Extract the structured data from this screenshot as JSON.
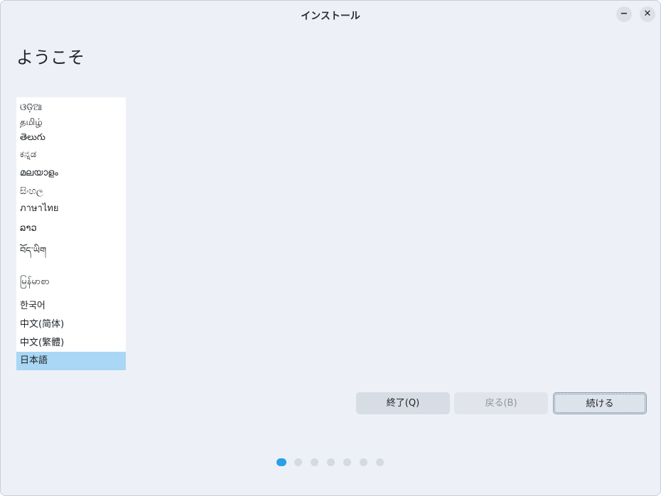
{
  "window": {
    "title": "インストール",
    "minimize_glyph": "−",
    "close_glyph": "✕"
  },
  "page": {
    "heading": "ようこそ"
  },
  "languages": {
    "items": [
      "ଓଡ଼ିଆ",
      "தமிழ்",
      "తెలుగు",
      "ಕನ್ನಡ",
      "മലയാളം",
      "සිංහල",
      "ภาษาไทย",
      "ລາວ",
      "བོད་ཡིག",
      "မြန်မာစာ",
      "한국어",
      "中文(简体)",
      "中文(繁體)",
      "日本語"
    ],
    "selected": "日本語"
  },
  "buttons": {
    "quit_label": "終了(Q)",
    "back_label": "戻る(B)",
    "continue_label": "続ける"
  },
  "pager": {
    "total": 7,
    "current": 1
  },
  "colors": {
    "accent": "#2d9fe8",
    "selection": "#a9d7f5",
    "window_bg": "#edf1f7"
  }
}
